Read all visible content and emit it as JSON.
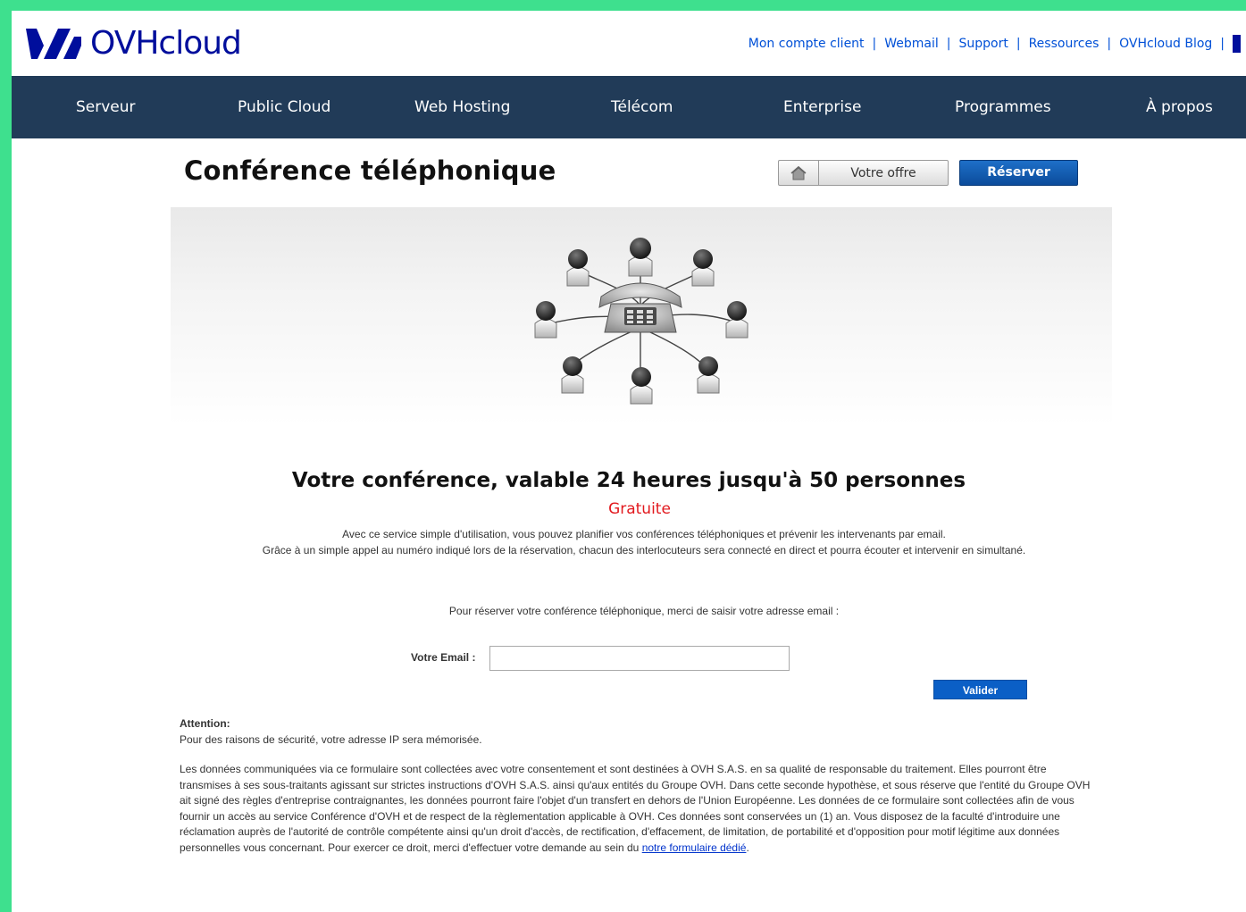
{
  "brand": {
    "name": "OVHcloud"
  },
  "toplinks": [
    "Mon compte client",
    "Webmail",
    "Support",
    "Ressources",
    "OVHcloud Blog"
  ],
  "nav": [
    "Serveur",
    "Public Cloud",
    "Web Hosting",
    "Télécom",
    "Enterprise",
    "Programmes",
    "À propos"
  ],
  "page": {
    "title": "Conférence téléphonique",
    "offer_button": "Votre offre",
    "reserve_button": "Réserver"
  },
  "content": {
    "headline": "Votre conférence, valable 24 heures jusqu'à 50 personnes",
    "price": "Gratuite",
    "desc_line1": "Avec ce service simple d'utilisation, vous pouvez planifier vos conférences téléphoniques et prévenir les intervenants par email.",
    "desc_line2": "Grâce à un simple appel au numéro indiqué lors de la réservation, chacun des interlocuteurs sera connecté en direct et pourra écouter et intervenir en simultané.",
    "prompt": "Pour réserver votre conférence téléphonique, merci de saisir votre adresse email :",
    "email_label": "Votre Email :",
    "email_value": "",
    "submit_label": "Valider"
  },
  "notice": {
    "attention_title": "Attention:",
    "attention_text": "Pour des raisons de sécurité, votre adresse IP sera mémorisée.",
    "legal_text": "Les données communiquées via ce formulaire sont collectées avec votre consentement et sont destinées à OVH S.A.S. en sa qualité de responsable du traitement. Elles pourront être transmises à ses sous-traitants agissant sur strictes instructions d'OVH S.A.S. ainsi qu'aux entités du Groupe OVH. Dans cette seconde hypothèse, et sous réserve que l'entité du Groupe OVH ait signé des règles d'entreprise contraignantes, les données pourront faire l'objet d'un transfert en dehors de l'Union Européenne. Les données de ce formulaire sont collectées afin de vous fournir un accès au service Conférence d'OVH et de respect de la règlementation applicable à OVH. Ces données sont conservées un (1) an. Vous disposez de la faculté d'introduire une réclamation auprès de l'autorité de contrôle compétente ainsi qu'un droit d'accès, de rectification, d'effacement, de limitation, de portabilité et d'opposition pour motif légitime aux données personnelles vous concernant. Pour exercer ce droit, merci d'effectuer votre demande au sein du",
    "legal_link": "notre formulaire dédié",
    "legal_end": "."
  },
  "colors": {
    "frame": "#3ee08e",
    "nav_bg": "#213b58",
    "brand_blue": "#000e9c",
    "link_blue": "#0050d7",
    "accent_red": "#e2191e",
    "button_blue": "#0b5fc6"
  },
  "icons": [
    "ovhcloud-logo-icon",
    "home-icon",
    "telephone-icon",
    "person-headset-icon"
  ]
}
